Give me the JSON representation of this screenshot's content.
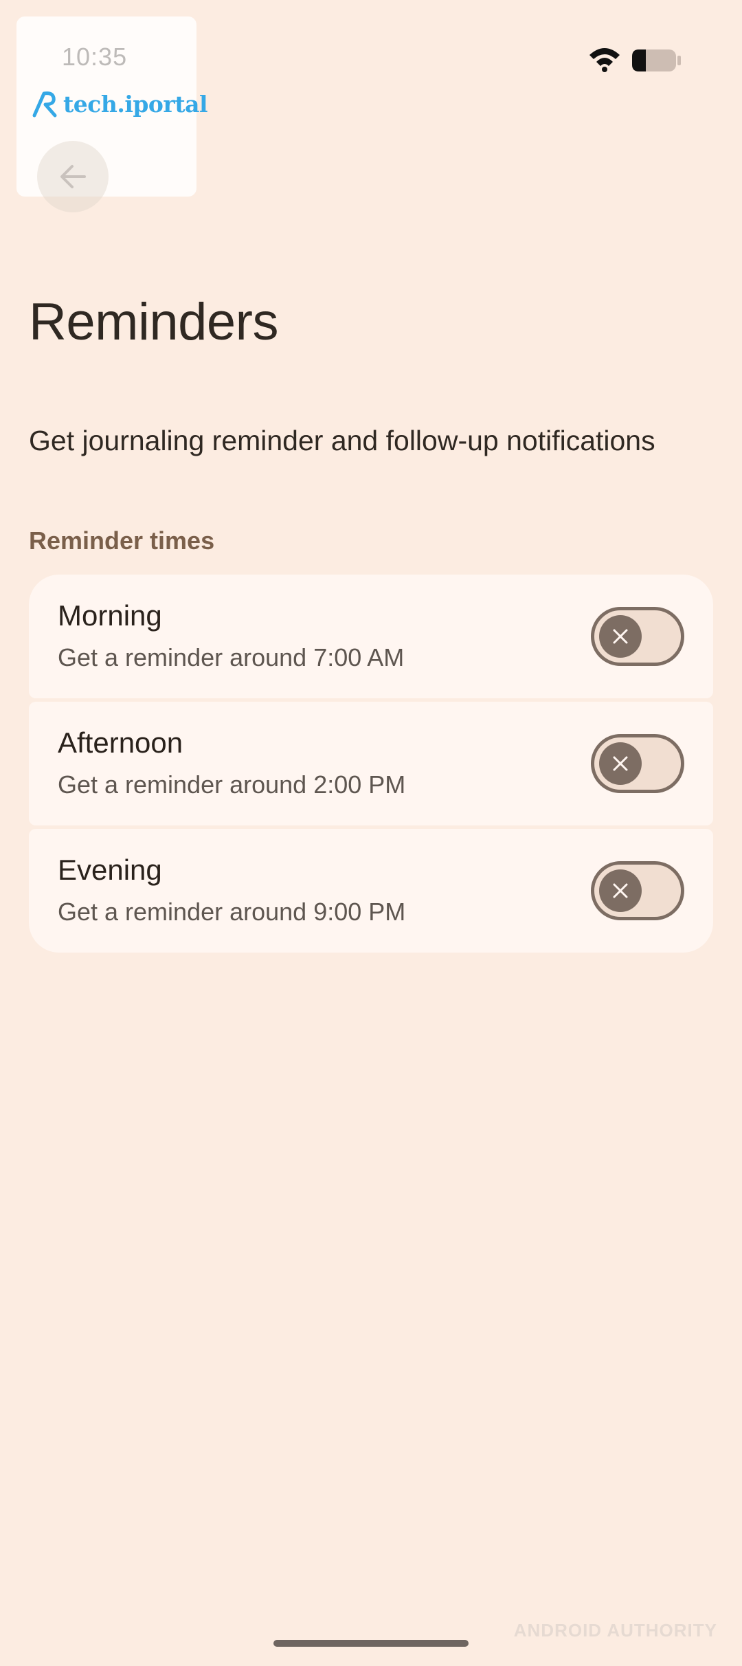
{
  "status_bar": {
    "time": "10:35",
    "wifi_icon": "wifi-icon",
    "battery_icon": "battery-icon"
  },
  "overlay": {
    "brand_text": "tech.iportal",
    "brand_color": "#35a8e6"
  },
  "header": {
    "back_icon": "arrow-back-icon"
  },
  "page": {
    "title": "Reminders",
    "description": "Get journaling reminder and follow-up notifications",
    "section_label": "Reminder times"
  },
  "reminders": [
    {
      "title": "Morning",
      "subtitle": "Get a reminder around 7:00 AM",
      "enabled": false
    },
    {
      "title": "Afternoon",
      "subtitle": "Get a reminder around 2:00 PM",
      "enabled": false
    },
    {
      "title": "Evening",
      "subtitle": "Get a reminder around 9:00 PM",
      "enabled": false
    }
  ],
  "watermark": "ANDROID AUTHORITY",
  "colors": {
    "background": "#fcece1",
    "card": "#fff6f1",
    "section_label": "#7a5f4a",
    "toggle_off": "#7d6d63"
  }
}
